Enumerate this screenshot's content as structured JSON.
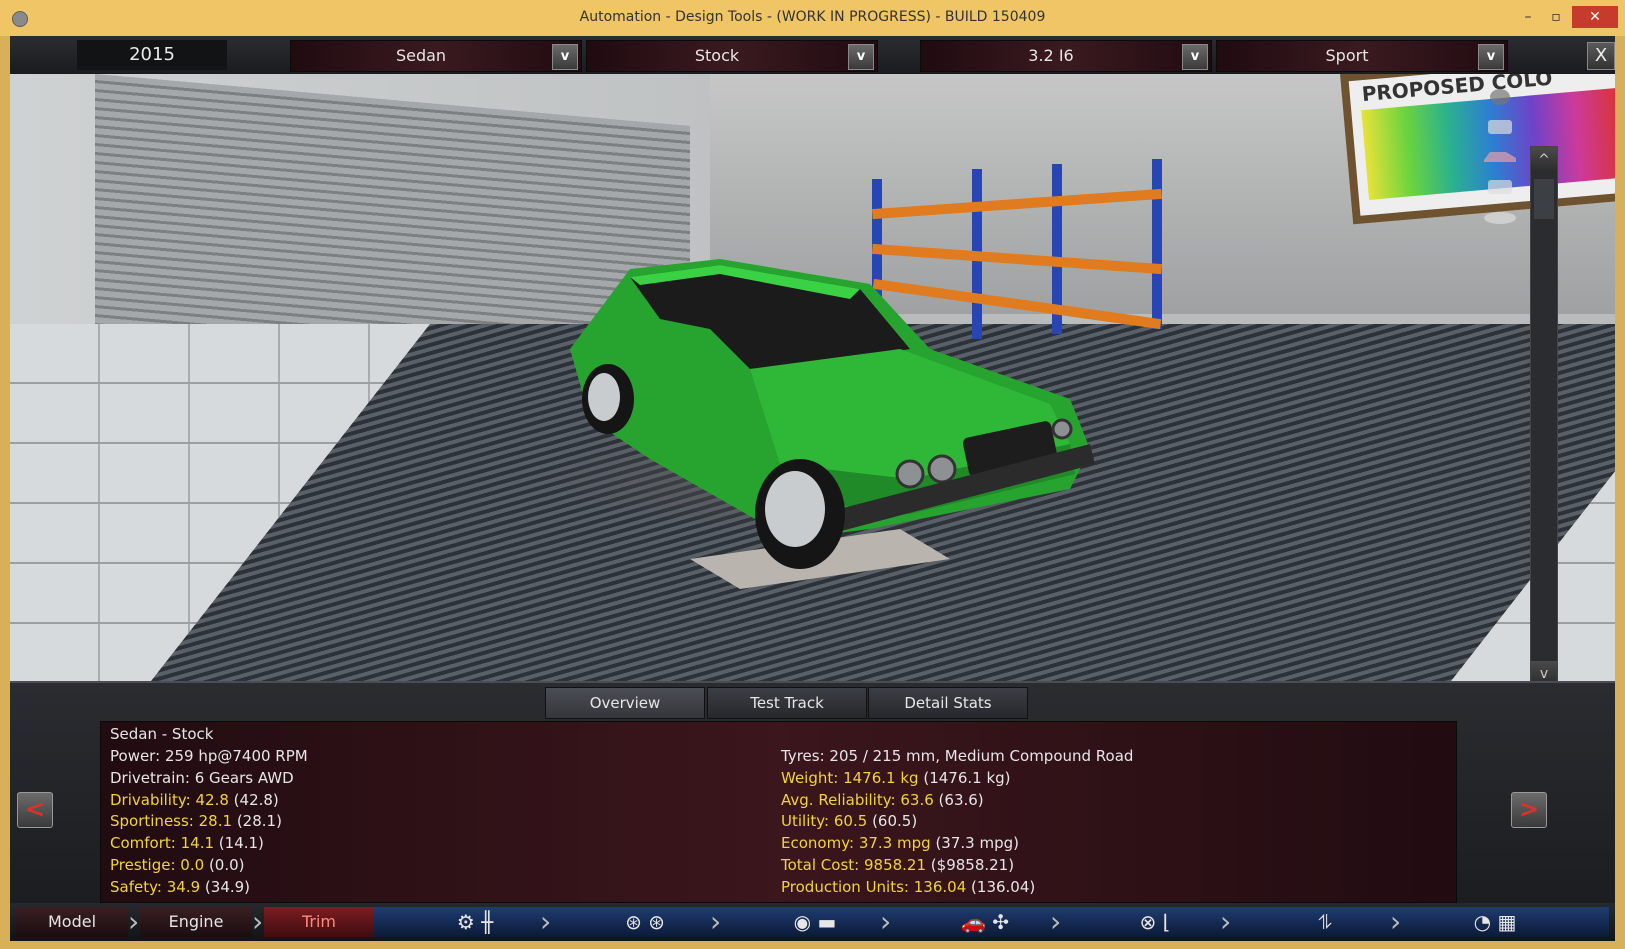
{
  "window": {
    "title": "Automation - Design Tools - (WORK IN PROGRESS) - BUILD 150409",
    "minimize": "–",
    "maximize": "▫",
    "close": "✕"
  },
  "topbar": {
    "year": "2015",
    "body": "Sedan",
    "variant": "Stock",
    "engine": "3.2 I6",
    "trim": "Sport",
    "dropdown_icon": "v",
    "close_label": "X"
  },
  "viewport": {
    "poster_text": "PROPOSED COLO",
    "scroll_up": "^",
    "scroll_down": "v"
  },
  "tabs": [
    "Overview",
    "Test Track",
    "Detail Stats"
  ],
  "panel": {
    "prev": "<",
    "next": ">",
    "header": "Sedan - Stock",
    "left": [
      {
        "label": "Power:",
        "value": "259 hp@7400 RPM",
        "extra": "",
        "highlight": false
      },
      {
        "label": "Drivetrain:",
        "value": "6 Gears AWD",
        "extra": "",
        "highlight": false
      },
      {
        "label": "Drivability:",
        "value": "42.8",
        "extra": "(42.8)",
        "highlight": true
      },
      {
        "label": "Sportiness:",
        "value": "28.1",
        "extra": "(28.1)",
        "highlight": true
      },
      {
        "label": "Comfort:",
        "value": "14.1",
        "extra": "(14.1)",
        "highlight": true
      },
      {
        "label": "Prestige:",
        "value": "0.0",
        "extra": "(0.0)",
        "highlight": true
      },
      {
        "label": "Safety:",
        "value": "34.9",
        "extra": "(34.9)",
        "highlight": true
      }
    ],
    "right": [
      {
        "label": "Tyres:",
        "value": "205 / 215 mm, Medium Compound Road",
        "extra": "",
        "highlight": false
      },
      {
        "label": "Weight:",
        "value": "1476.1 kg",
        "extra": "(1476.1 kg)",
        "highlight": true
      },
      {
        "label": "Avg. Reliability:",
        "value": "63.6",
        "extra": "(63.6)",
        "highlight": true
      },
      {
        "label": "Utility:",
        "value": "60.5",
        "extra": "(60.5)",
        "highlight": true
      },
      {
        "label": "Economy:",
        "value": "37.3 mpg",
        "extra": "(37.3 mpg)",
        "highlight": true
      },
      {
        "label": "Total Cost:",
        "value": "9858.21",
        "extra": "($9858.21)",
        "highlight": true
      },
      {
        "label": "Production Units:",
        "value": "136.04",
        "extra": "(136.04)",
        "highlight": true
      }
    ]
  },
  "bottombar": {
    "steps": [
      "Model",
      "Engine",
      "Trim"
    ],
    "chevron": "›",
    "icon_names": [
      "gearbox-icon",
      "wheels-icon",
      "body-paint-icon",
      "aero-cooling-icon",
      "interior-steering-icon",
      "suspension-icon",
      "test-drive-icon"
    ],
    "icons": [
      "⚙ ╫",
      "⊛ ⊛",
      "◉ ▬",
      "🚗 ✣",
      "⊗ ⌊",
      "⥮",
      "◔ ▦"
    ]
  },
  "colors": {
    "title_bar": "#f0c565",
    "highlight_text": "#f1d33a",
    "stats_bg": "#3b161c",
    "active_step": "#7b1d22",
    "car_body": "#27a32f"
  }
}
